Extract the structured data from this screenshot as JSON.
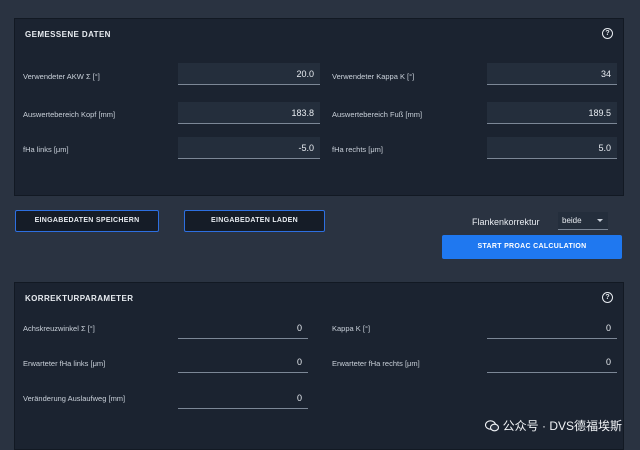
{
  "measured": {
    "title": "GEMESSENE DATEN",
    "help": "?",
    "rows": [
      {
        "left_label": "Verwendeter AKW Σ [°]",
        "left_value": "20.0",
        "right_label": "Verwendeter Kappa K [°]",
        "right_value": "34"
      },
      {
        "left_label": "Auswertebereich Kopf [mm]",
        "left_value": "183.8",
        "right_label": "Auswertebereich Fuß [mm]",
        "right_value": "189.5"
      },
      {
        "left_label": "fHa links [μm]",
        "left_value": "-5.0",
        "right_label": "fHa rechts [μm]",
        "right_value": "5.0"
      }
    ]
  },
  "actions": {
    "save_label": "EINGABEDATEN SPEICHERN",
    "load_label": "EINGABEDATEN LADEN",
    "flank_label": "Flankenkorrektur",
    "flank_value": "beide",
    "start_label": "START PROAC CALCULATION"
  },
  "correction": {
    "title": "KORREKTURPARAMETER",
    "help": "?",
    "rows": [
      {
        "left_label": "Achskreuzwinkel Σ [°]",
        "left_value": "0",
        "right_label": "Kappa K [°]",
        "right_value": "0"
      },
      {
        "left_label": "Erwarteter fHa links [μm]",
        "left_value": "0",
        "right_label": "Erwarteter fHa rechts [μm]",
        "right_value": "0"
      },
      {
        "left_label": "Veränderung Auslaufweg [mm]",
        "left_value": "0"
      }
    ]
  },
  "watermark": {
    "text": "公众号 · DVS德福埃斯",
    "icon": "wechat-icon"
  }
}
